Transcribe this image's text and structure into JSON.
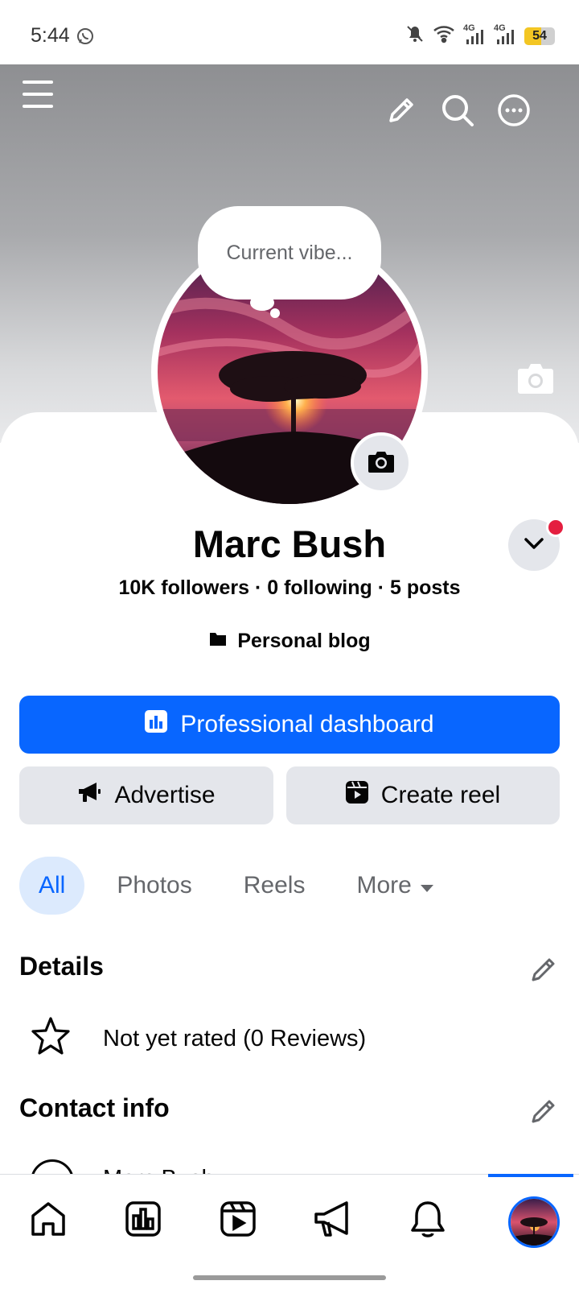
{
  "status": {
    "time": "5:44",
    "battery": "54",
    "battery_level": 0.54,
    "network_1": "4G",
    "network_2": "4G"
  },
  "profile": {
    "vibe_placeholder": "Current vibe...",
    "name": "Marc Bush",
    "stats": "10K followers · 0 following · 5 posts",
    "category": "Personal blog"
  },
  "actions": {
    "dashboard": "Professional dashboard",
    "advertise": "Advertise",
    "create_reel": "Create reel"
  },
  "filters": [
    {
      "label": "All",
      "active": true
    },
    {
      "label": "Photos",
      "active": false
    },
    {
      "label": "Reels",
      "active": false
    },
    {
      "label": "More",
      "active": false
    }
  ],
  "details": {
    "title": "Details",
    "rating": "Not yet rated (0 Reviews)"
  },
  "contact": {
    "title": "Contact info",
    "peek_text": "Marc Bush"
  },
  "colors": {
    "accent": "#0866ff",
    "chip_bg": "#dceafd",
    "button_grey": "#e4e6eb",
    "badge_red": "#e41e3f"
  },
  "nav": [
    "home-icon",
    "dashboard-icon",
    "reels-icon",
    "ads-megaphone-icon",
    "notifications-bell-icon",
    "profile-avatar"
  ]
}
